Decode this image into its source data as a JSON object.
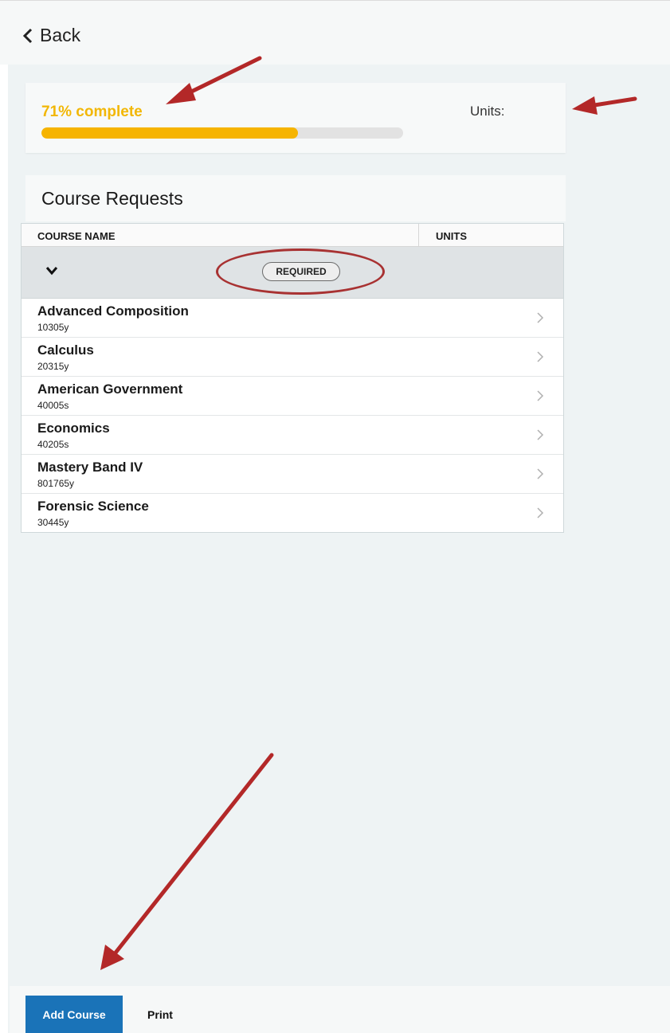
{
  "nav": {
    "back_label": "Back"
  },
  "progress": {
    "label": "71% complete",
    "percent": 71,
    "units_label": "Units:"
  },
  "colors": {
    "accent": "#f6b400",
    "primary_button": "#1a73b8",
    "annotation_red": "#b32828"
  },
  "requests": {
    "title": "Course Requests",
    "columns": {
      "name": "COURSE NAME",
      "units": "UNITS"
    },
    "group_label": "REQUIRED",
    "courses": [
      {
        "name": "Advanced Composition",
        "code": "10305y"
      },
      {
        "name": "Calculus",
        "code": "20315y"
      },
      {
        "name": "American Government",
        "code": "40005s"
      },
      {
        "name": "Economics",
        "code": "40205s"
      },
      {
        "name": "Mastery Band IV",
        "code": "801765y"
      },
      {
        "name": "Forensic Science",
        "code": "30445y"
      }
    ]
  },
  "actions": {
    "add_course_label": "Add Course",
    "print_label": "Print"
  },
  "icons": {
    "back": "chevron-left-icon",
    "group_toggle": "chevron-down-icon",
    "row": "chevron-right-icon"
  }
}
